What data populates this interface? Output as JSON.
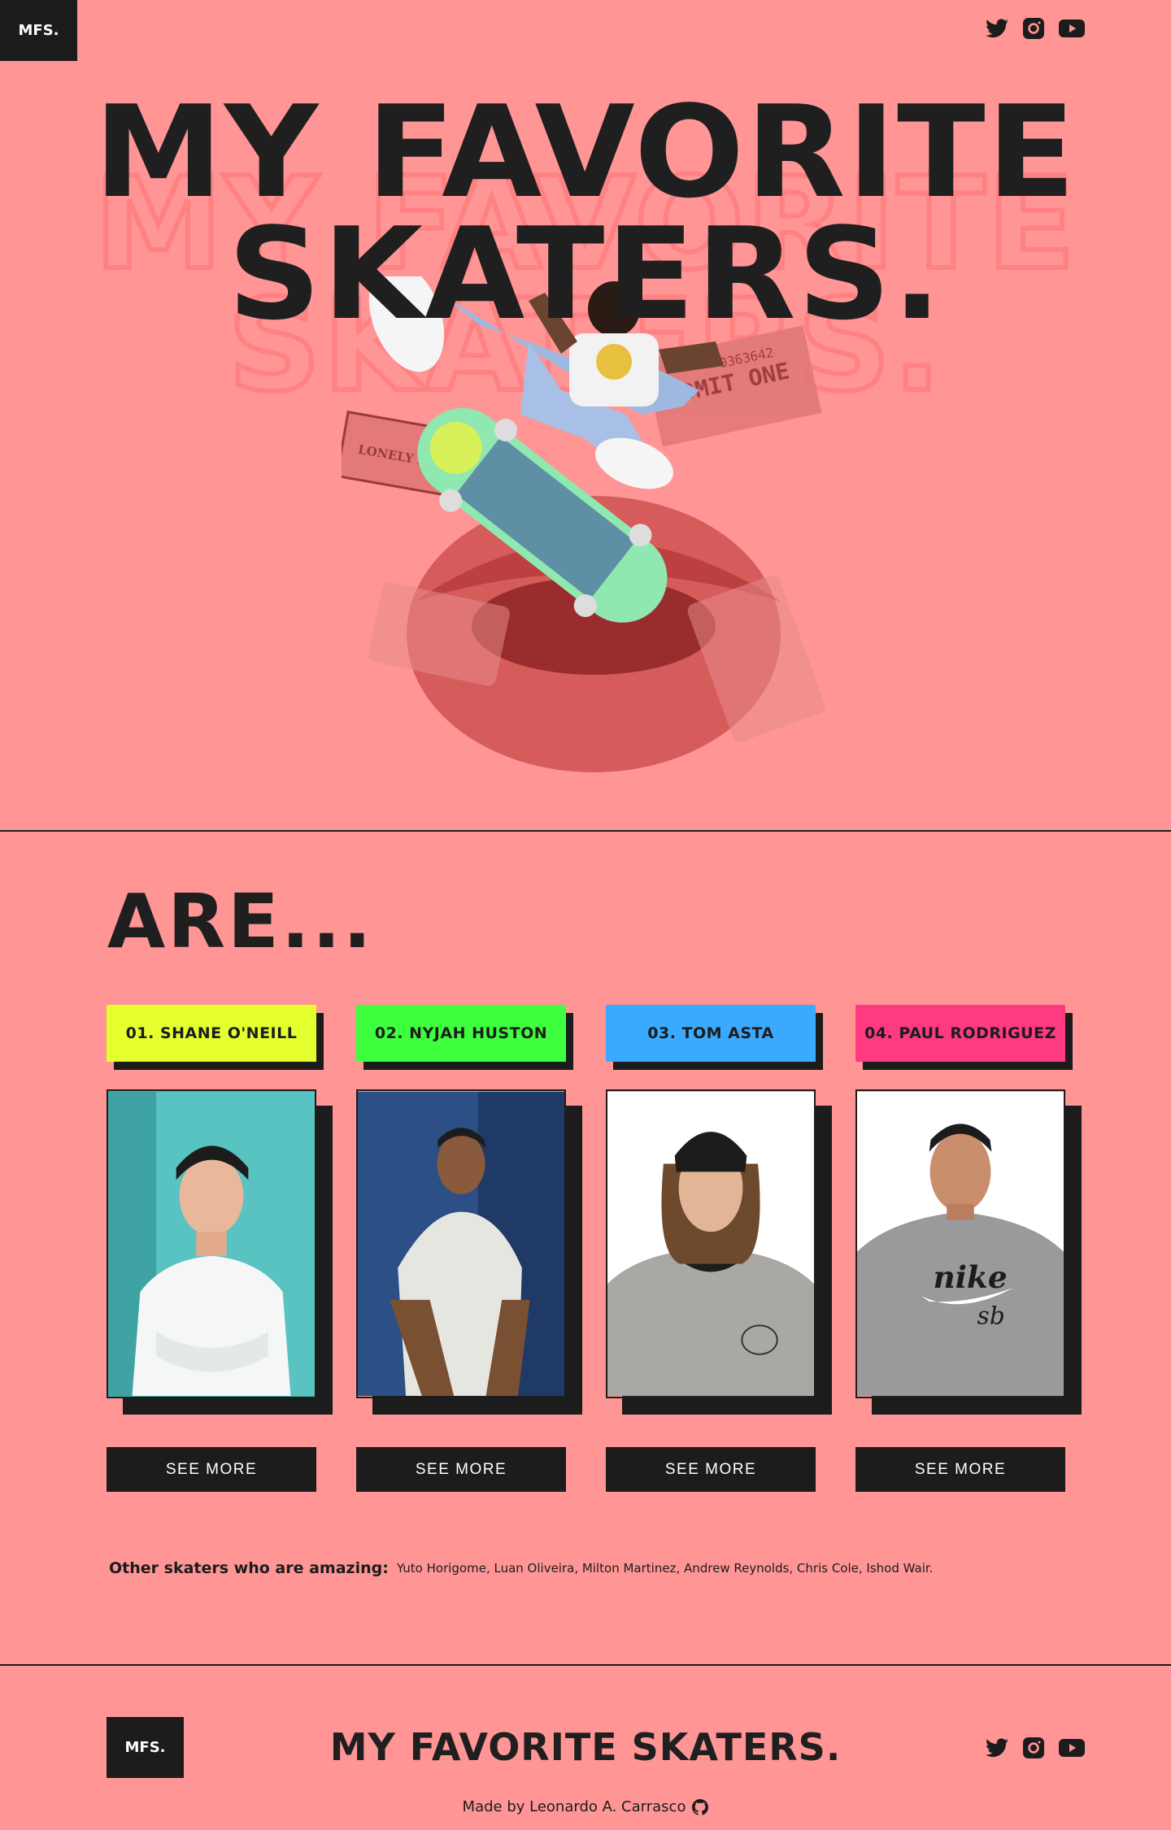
{
  "header": {
    "logo": "MFS.",
    "social_icons": [
      "twitter-icon",
      "instagram-icon",
      "youtube-icon"
    ]
  },
  "hero": {
    "title_line1": "MY FAVORITE",
    "title_line2": "SKATERS.",
    "sticker_text": "LONELY HEARTS CLUB",
    "ticket_text": "ADMIT ONE",
    "ticket_number": "0363642"
  },
  "section": {
    "title": "ARE...",
    "skaters": [
      {
        "label": "01. SHANE O'NEILL",
        "tag_color": "#e5ff2e",
        "button": "SEE MORE",
        "photo_bg": "#46b3b5"
      },
      {
        "label": "02. NYJAH HUSTON",
        "tag_color": "#3dff3d",
        "button": "SEE MORE",
        "photo_bg": "#2a4a7a"
      },
      {
        "label": "03. TOM ASTA",
        "tag_color": "#3aaaff",
        "button": "SEE MORE",
        "photo_bg": "#ffffff"
      },
      {
        "label": "04. PAUL RODRIGUEZ",
        "tag_color": "#ff3a80",
        "button": "SEE MORE",
        "photo_bg": "#ffffff"
      }
    ],
    "shirt_brand": "nike",
    "shirt_sub": "sb",
    "others_label": "Other skaters who are amazing:",
    "others_names": "Yuto Horigome, Luan Oliveira, Milton Martinez, Andrew Reynolds, Chris Cole, Ishod Wair."
  },
  "footer": {
    "logo": "MFS.",
    "title": "MY FAVORITE SKATERS.",
    "credit": "Made by Leonardo A. Carrasco"
  },
  "colors": {
    "background": "#ff9595",
    "ink": "#1c1c1c"
  }
}
